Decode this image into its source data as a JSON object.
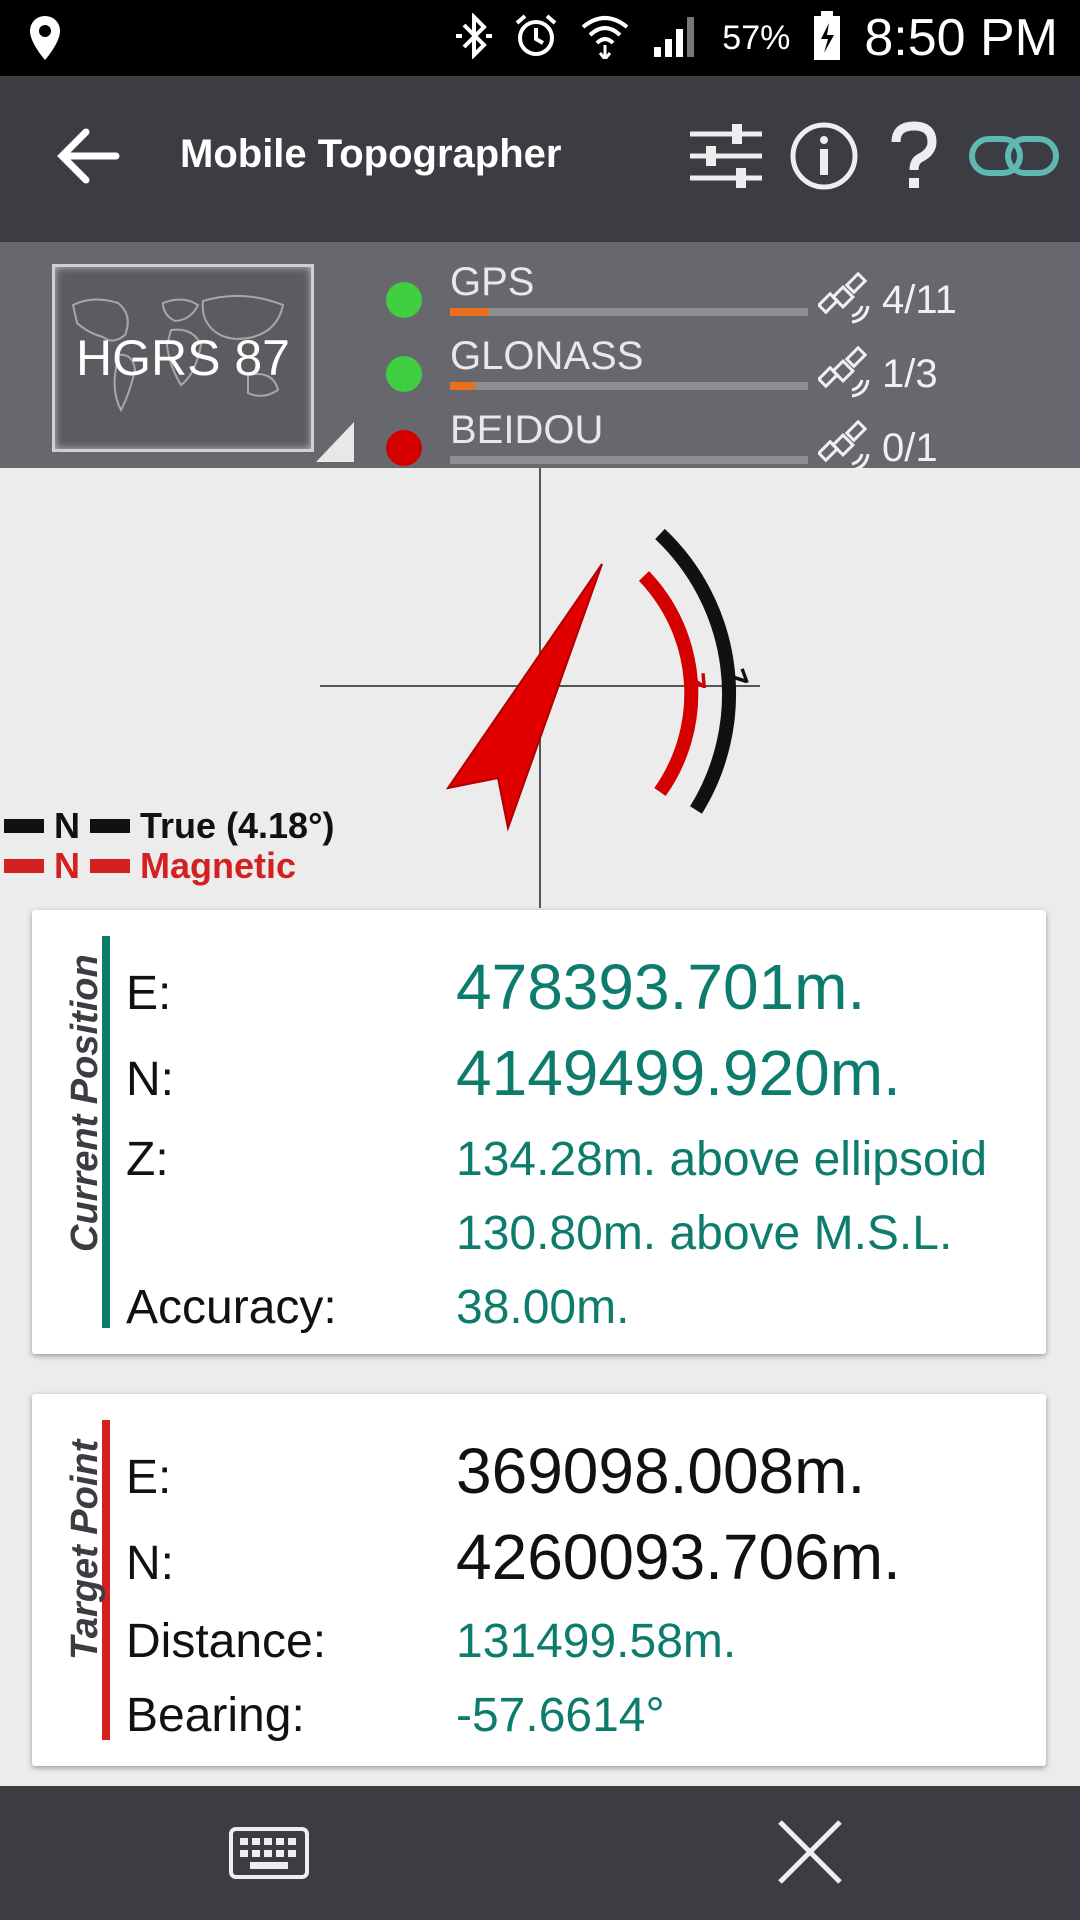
{
  "statusbar": {
    "battery": "57%",
    "time": "8:50 PM"
  },
  "toolbar": {
    "title": "Mobile Topographer"
  },
  "datum": {
    "label": "HGRS 87"
  },
  "gnss": [
    {
      "name": "GPS",
      "count": "4/11",
      "status_color": "#3fce3f",
      "signal": 0.11
    },
    {
      "name": "GLONASS",
      "count": "1/3",
      "status_color": "#3fce3f",
      "signal": 0.07
    },
    {
      "name": "BEIDOU",
      "count": "0/1",
      "status_color": "#d40000",
      "signal": 0
    }
  ],
  "legend": {
    "true_n": "N",
    "true_label": "True (4.18°)",
    "mag_n": "N",
    "mag_label": "Magnetic"
  },
  "current_position": {
    "title": "Current Position",
    "e_label": "E:",
    "e_value": "478393.701m.",
    "n_label": "N:",
    "n_value": "4149499.920m.",
    "z_label": "Z:",
    "z_value_ellipsoid": "134.28m. above ellipsoid",
    "z_value_msl": "130.80m. above M.S.L.",
    "acc_label": "Accuracy:",
    "acc_value": "38.00m."
  },
  "target_point": {
    "title": "Target Point",
    "e_label": "E:",
    "e_value": "369098.008m.",
    "n_label": "N:",
    "n_value": "4260093.706m.",
    "dist_label": "Distance:",
    "dist_value": "131499.58m.",
    "bearing_label": "Bearing:",
    "bearing_value": "-57.6614°"
  },
  "colors": {
    "toolbar": "#3b3d42",
    "teal": "#0e7c6c",
    "red": "#d40000",
    "accent_link": "#5fb8b2"
  },
  "icons": [
    "location-pin-icon",
    "bluetooth-icon",
    "alarm-icon",
    "wifi-icon",
    "signal-icon",
    "battery-icon",
    "back-arrow-icon",
    "sliders-icon",
    "info-icon",
    "help-icon",
    "link-icon",
    "world-map-icon",
    "satellite-icon",
    "keyboard-icon",
    "close-icon"
  ]
}
